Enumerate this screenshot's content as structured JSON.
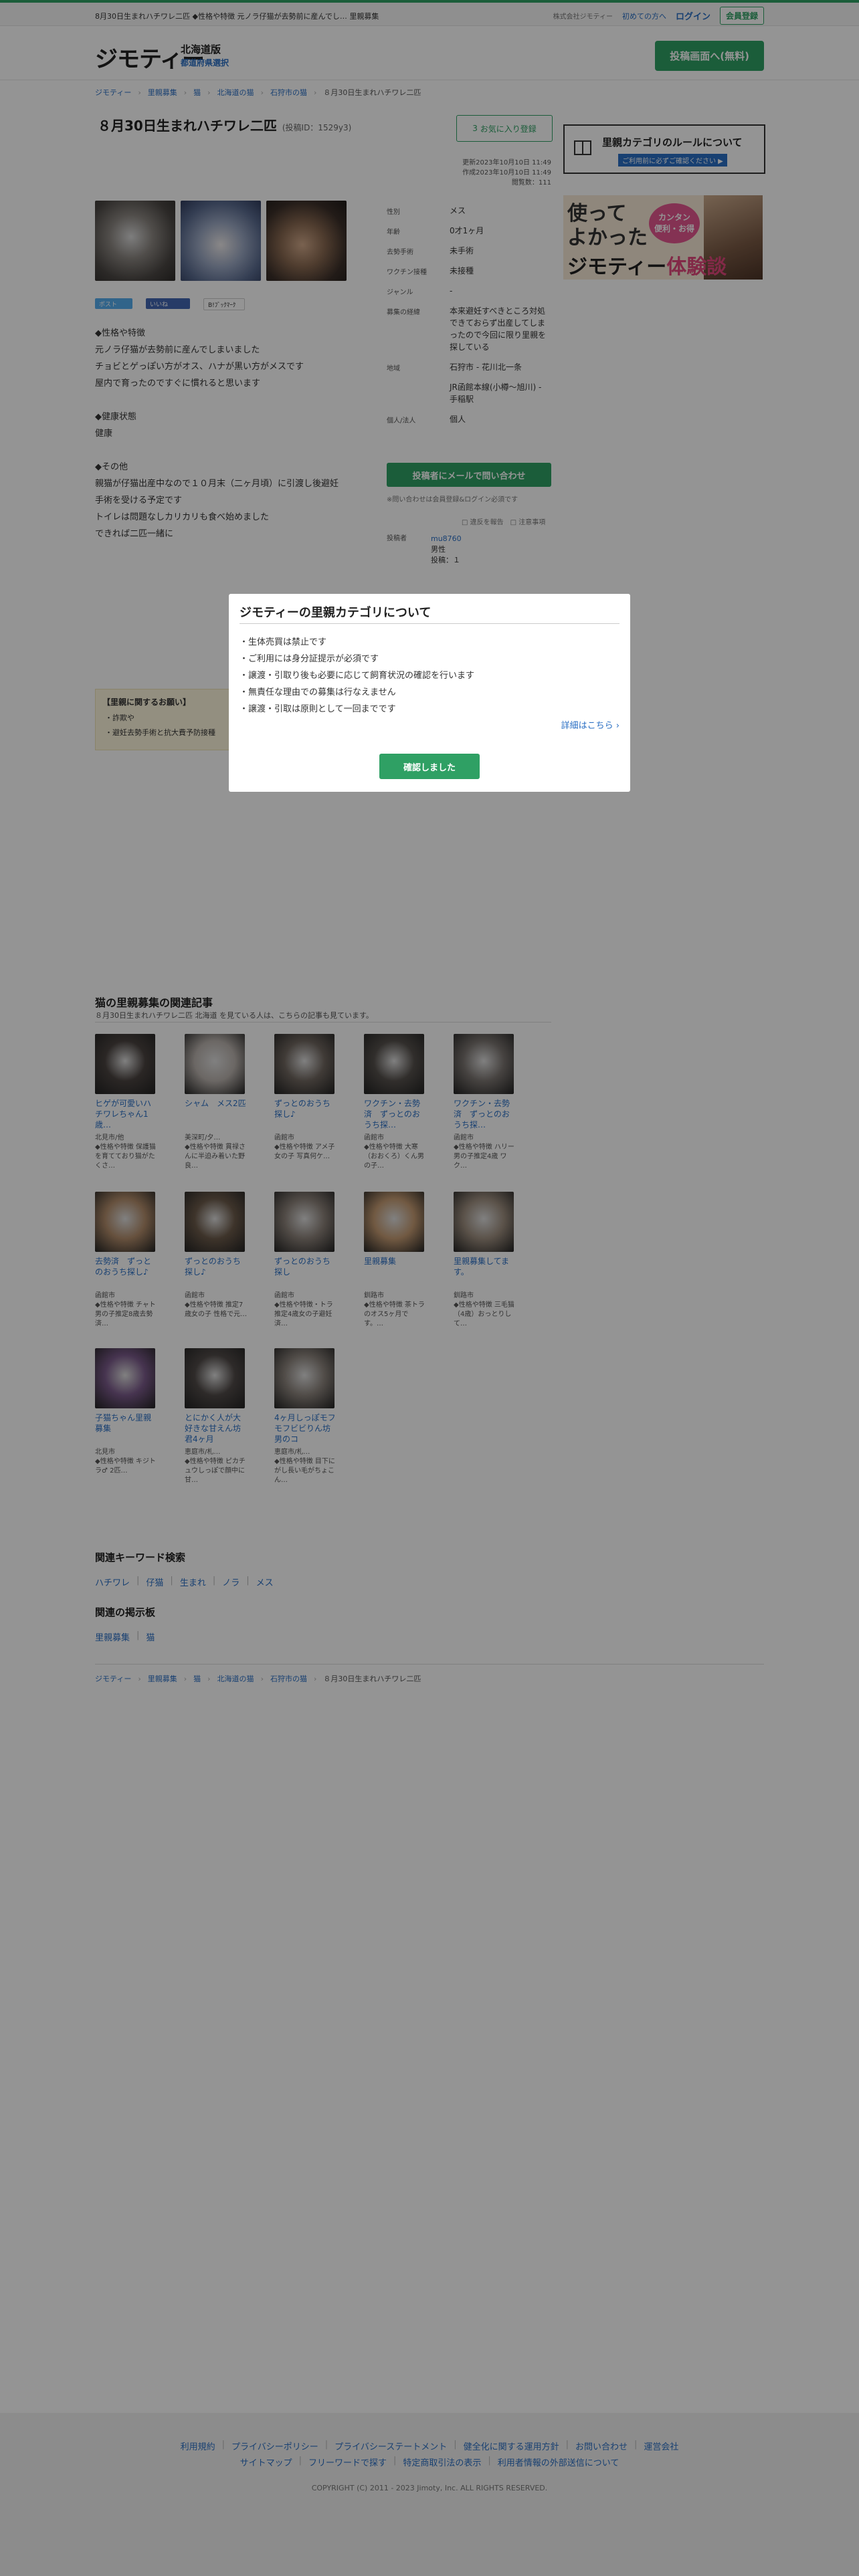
{
  "topbar": {
    "breadcrumb_text": "8月30日生まれハチワレ二匹 ◆性格や特徴 元ノラ仔猫が去勢前に産んでし… 里親募集",
    "operator": "株式会社ジモティー",
    "first_time": "初めての方へ",
    "login": "ログイン",
    "register": "会員登録"
  },
  "header": {
    "logo": "ジモティー",
    "pref": "北海道版",
    "pref_select": "都道府県選択",
    "post_button": "投稿画面へ(無料)"
  },
  "breadcrumb": [
    "ジモティー",
    "里親募集",
    "猫",
    "北海道の猫",
    "石狩市の猫",
    "８月30日生まれハチワレ二匹"
  ],
  "post": {
    "title": "８月30日生まれハチワレ二匹",
    "post_id": "(投稿ID：1529y3)",
    "fav_button": "お気に入り登録",
    "fav_count": "3",
    "updated": "更新2023年10月10日 11:49",
    "created": "作成2023年10月10日 11:49",
    "views": "閲覧数：111",
    "body": "◆性格や特徴\n元ノラ仔猫が去勢前に産んでしまいました\nチョビとゲっぽい方がオス、ハナが黒い方がメスです\n屋内で育ったのですぐに慣れると思います\n\n◆健康状態\n健康\n\n◆その他\n親猫が仔猫出産中なので１０月末（二ヶ月頃）に引渡し後避妊\n手術を受ける予定です\nトイレは問題なしカリカリも食べ始めました\nできれば二匹一緒に"
  },
  "social": {
    "tweet": "ポスト",
    "like": "いいね",
    "hatena": "B!ﾌﾞｯｸﾏｰｸ"
  },
  "info": [
    {
      "k": "性別",
      "v": "メス"
    },
    {
      "k": "年齢",
      "v": "0才1ヶ月"
    },
    {
      "k": "去勢手術",
      "v": "未手術"
    },
    {
      "k": "ワクチン接種",
      "v": "未接種"
    },
    {
      "k": "ジャンル",
      "v": "-"
    },
    {
      "k": "募集の経緯",
      "v": "本来避妊すべきところ対処できておらず出産してしまったので今回に限り里親を探している"
    },
    {
      "k": "地域",
      "v": "石狩市 - 花川北一条",
      "link": true
    },
    {
      "k": "",
      "v": "JR函館本線(小樽〜旭川) - 手稲駅",
      "link": true
    },
    {
      "k": "個人/法人",
      "v": "個人"
    }
  ],
  "contact": {
    "button": "投稿者にメールで問い合わせ",
    "note": "※問い合わせは会員登録&ログイン必須です",
    "report": "□ 違反を報告　□ 注意事項"
  },
  "poster": {
    "label": "投稿者",
    "name": "mu8760",
    "gender": "男性",
    "count": "投稿：１"
  },
  "notice": {
    "heading": "【里親に関するお願い】",
    "line1": "・詐欺や",
    "line2": "・避妊去勢手術と抗大費予防接種"
  },
  "banners": {
    "rules_title": "里親カテゴリのルールについて",
    "rules_sub": "ご利用前に必ずご確認ください ▶",
    "exp_line1": "使って",
    "exp_line2": "よかった",
    "exp_bubble1": "カンタン",
    "exp_bubble2": "便利・お得",
    "exp_brand": "ジモティー",
    "exp_word": "体験談"
  },
  "related": {
    "heading": "猫の里親募集の関連記事",
    "sub": "８月30日生まれハチワレ二匹 北海道 を見ている人は、こちらの記事も見ています。",
    "items": [
      {
        "title": "ヒゲが可愛いハチワレちゃん1歳…",
        "loc": "北見市/他",
        "desc": "◆性格や特徴 保護猫を育てており猫がたくさ…",
        "c": "#4a4340"
      },
      {
        "title": "シャム　メス2匹",
        "loc": "美深町/夕…",
        "desc": "◆性格や特徴 貫禄さんに半迫み着いた野良…",
        "c": "#b9b2ad"
      },
      {
        "title": "ずっとのおうち探し♪",
        "loc": "函館市",
        "desc": "◆性格や特徴 アメ子女の子 写真何ケ…",
        "c": "#6f665f"
      },
      {
        "title": "ワクチン・去勢済　ずっとのおうち探…",
        "loc": "函館市",
        "desc": "◆性格や特徴 大寒（おおくろ）くん男の子…",
        "c": "#55504c"
      },
      {
        "title": "ワクチン・去勢済　ずっとのおうち探…",
        "loc": "函館市",
        "desc": "◆性格や特徴 ハリー男の子推定4歳 ワク…",
        "c": "#7a7470"
      },
      {
        "title": "去勢済　ずっとのおうち探し♪",
        "loc": "函館市",
        "desc": "◆性格や特徴 チャト男の子推定8歳去勢済…",
        "c": "#b08b6a"
      },
      {
        "title": "ずっとのおうち探し♪",
        "loc": "函館市",
        "desc": "◆性格や特徴 推定7歳女の子 性格で元…",
        "c": "#6b5a4a"
      },
      {
        "title": "ずっとのおうち探し",
        "loc": "函館市",
        "desc": "◆性格や特徴・トラ推定4歳女の子避妊済…",
        "c": "#8a8078"
      },
      {
        "title": "里親募集",
        "loc": "釧路市",
        "desc": "◆性格や特徴 茶トラのオス5ヶ月です。…",
        "c": "#c39a72"
      },
      {
        "title": "里親募集してます。",
        "loc": "釧路市",
        "desc": "◆性格や特徴 三毛猫（4歳）おっとりして…",
        "c": "#9d8e7f"
      },
      {
        "title": "子猫ちゃん里親募集",
        "loc": "北見市",
        "desc": "◆性格や特徴 キジトラ♂ 2匹…",
        "c": "#7a5a8a"
      },
      {
        "title": "とにかく人が大好きな甘えん坊君4ヶ月",
        "loc": "恵庭市/札…",
        "desc": "◆性格や特徴 ピカチュウしっぽで顔中に甘…",
        "c": "#504a48"
      },
      {
        "title": "4ヶ月しっぽモフモフビビりん坊男のコ",
        "loc": "恵庭市/札…",
        "desc": "◆性格や特徴 目下にがし長い毛がちょこん…",
        "c": "#8b837c"
      }
    ]
  },
  "keywords": {
    "heading": "関連キーワード検索",
    "items": [
      "ハチワレ",
      "仔猫",
      "生まれ",
      "ノラ",
      "メス"
    ]
  },
  "boards": {
    "heading": "関連の掲示板",
    "items": [
      "里親募集",
      "猫"
    ]
  },
  "footer": {
    "links1": [
      "利用規約",
      "プライバシーポリシー",
      "プライバシーステートメント",
      "健全化に関する運用方針",
      "お問い合わせ",
      "運営会社"
    ],
    "links2": [
      "サイトマップ",
      "フリーワードで探す",
      "特定商取引法の表示",
      "利用者情報の外部送信について"
    ],
    "copyright": "COPYRIGHT (C) 2011 - 2023 Jimoty, Inc. ALL RIGHTS RESERVED."
  },
  "modal": {
    "title": "ジモティーの里親カテゴリについて",
    "items": [
      "生体売買は禁止です",
      "ご利用には身分証提示が必須です",
      "譲渡・引取り後も必要に応じて飼育状況の確認を行います",
      "無責任な理由での募集は行なえません",
      "譲渡・引取は原則として一回までです"
    ],
    "more": "詳細はこちら ›",
    "ok": "確認しました"
  }
}
